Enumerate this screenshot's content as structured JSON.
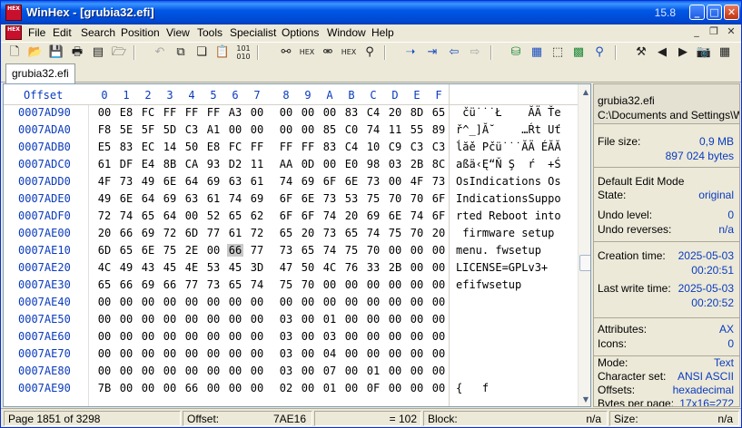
{
  "window": {
    "title": "WinHex - [grubia32.efi]",
    "version": "15.8",
    "logo_text": "HEX"
  },
  "menu": {
    "items": [
      "File",
      "Edit",
      "Search",
      "Position",
      "View",
      "Tools",
      "Specialist",
      "Options",
      "Window",
      "Help"
    ]
  },
  "toolbar": {
    "icons": [
      "new-file-icon",
      "open-folder-icon",
      "save-icon",
      "print-icon",
      "properties-icon",
      "open-folder-alt-icon",
      "undo-icon",
      "copy-block-icon",
      "copy-icon",
      "paste-icon",
      "write-clipboard-icon",
      "hex-convert-icon",
      "find-text-icon",
      "find-hex-icon",
      "replace-text-icon",
      "replace-hex-icon",
      "find-again-icon",
      "goto-offset-icon",
      "goto-sector-icon",
      "back-icon",
      "forward-icon",
      "disk-editor-icon",
      "open-ram-icon",
      "floppy-icon",
      "calculator-icon",
      "search-icon",
      "clean-icon",
      "prev-icon",
      "next-icon",
      "camera-icon",
      "grid-icon"
    ]
  },
  "tabs": {
    "active": "grubia32.efi"
  },
  "editor": {
    "offset_label": "Offset",
    "columns": [
      "0",
      "1",
      "2",
      "3",
      "4",
      "5",
      "6",
      "7",
      "8",
      "9",
      "A",
      "B",
      "C",
      "D",
      "E",
      "F"
    ],
    "selected": {
      "row": 8,
      "col": 6
    },
    "rows": [
      {
        "offset": "0007AD90",
        "bytes": [
          "00",
          "E8",
          "FC",
          "FF",
          "FF",
          "FF",
          "A3",
          "00",
          "00",
          "00",
          "00",
          "83",
          "C4",
          "20",
          "8D",
          "65"
        ],
        "text": " čü˙˙˙Ł    ĂÄ Ťe"
      },
      {
        "offset": "0007ADA0",
        "bytes": [
          "F8",
          "5E",
          "5F",
          "5D",
          "C3",
          "A1",
          "00",
          "00",
          "00",
          "00",
          "85",
          "C0",
          "74",
          "11",
          "55",
          "89"
        ],
        "text": "ř^_]Ă˘    …Ŕt Uť"
      },
      {
        "offset": "0007ADB0",
        "bytes": [
          "E5",
          "83",
          "EC",
          "14",
          "50",
          "E8",
          "FC",
          "FF",
          "FF",
          "FF",
          "83",
          "C4",
          "10",
          "C9",
          "C3",
          "C3"
        ],
        "text": "ĺăě Pčü˙˙˙ĂÄ ÉĂĂ"
      },
      {
        "offset": "0007ADC0",
        "bytes": [
          "61",
          "DF",
          "E4",
          "8B",
          "CA",
          "93",
          "D2",
          "11",
          "AA",
          "0D",
          "00",
          "E0",
          "98",
          "03",
          "2B",
          "8C"
        ],
        "text": "aßä‹Ę“Ň Ş  ŕ  +Ś"
      },
      {
        "offset": "0007ADD0",
        "bytes": [
          "4F",
          "73",
          "49",
          "6E",
          "64",
          "69",
          "63",
          "61",
          "74",
          "69",
          "6F",
          "6E",
          "73",
          "00",
          "4F",
          "73"
        ],
        "text": "OsIndications Os"
      },
      {
        "offset": "0007ADE0",
        "bytes": [
          "49",
          "6E",
          "64",
          "69",
          "63",
          "61",
          "74",
          "69",
          "6F",
          "6E",
          "73",
          "53",
          "75",
          "70",
          "70",
          "6F"
        ],
        "text": "IndicationsSuppo"
      },
      {
        "offset": "0007ADF0",
        "bytes": [
          "72",
          "74",
          "65",
          "64",
          "00",
          "52",
          "65",
          "62",
          "6F",
          "6F",
          "74",
          "20",
          "69",
          "6E",
          "74",
          "6F"
        ],
        "text": "rted Reboot into"
      },
      {
        "offset": "0007AE00",
        "bytes": [
          "20",
          "66",
          "69",
          "72",
          "6D",
          "77",
          "61",
          "72",
          "65",
          "20",
          "73",
          "65",
          "74",
          "75",
          "70",
          "20"
        ],
        "text": " firmware setup "
      },
      {
        "offset": "0007AE10",
        "bytes": [
          "6D",
          "65",
          "6E",
          "75",
          "2E",
          "00",
          "66",
          "77",
          "73",
          "65",
          "74",
          "75",
          "70",
          "00",
          "00",
          "00"
        ],
        "text": "menu. fwsetup   "
      },
      {
        "offset": "0007AE20",
        "bytes": [
          "4C",
          "49",
          "43",
          "45",
          "4E",
          "53",
          "45",
          "3D",
          "47",
          "50",
          "4C",
          "76",
          "33",
          "2B",
          "00",
          "00"
        ],
        "text": "LICENSE=GPLv3+  "
      },
      {
        "offset": "0007AE30",
        "bytes": [
          "65",
          "66",
          "69",
          "66",
          "77",
          "73",
          "65",
          "74",
          "75",
          "70",
          "00",
          "00",
          "00",
          "00",
          "00",
          "00"
        ],
        "text": "efifwsetup      "
      },
      {
        "offset": "0007AE40",
        "bytes": [
          "00",
          "00",
          "00",
          "00",
          "00",
          "00",
          "00",
          "00",
          "00",
          "00",
          "00",
          "00",
          "00",
          "00",
          "00",
          "00"
        ],
        "text": ""
      },
      {
        "offset": "0007AE50",
        "bytes": [
          "00",
          "00",
          "00",
          "00",
          "00",
          "00",
          "00",
          "00",
          "03",
          "00",
          "01",
          "00",
          "00",
          "00",
          "00",
          "00"
        ],
        "text": ""
      },
      {
        "offset": "0007AE60",
        "bytes": [
          "00",
          "00",
          "00",
          "00",
          "00",
          "00",
          "00",
          "00",
          "03",
          "00",
          "03",
          "00",
          "00",
          "00",
          "00",
          "00"
        ],
        "text": ""
      },
      {
        "offset": "0007AE70",
        "bytes": [
          "00",
          "00",
          "00",
          "00",
          "00",
          "00",
          "00",
          "00",
          "03",
          "00",
          "04",
          "00",
          "00",
          "00",
          "00",
          "00"
        ],
        "text": ""
      },
      {
        "offset": "0007AE80",
        "bytes": [
          "00",
          "00",
          "00",
          "00",
          "00",
          "00",
          "00",
          "00",
          "03",
          "00",
          "07",
          "00",
          "01",
          "00",
          "00",
          "00"
        ],
        "text": ""
      },
      {
        "offset": "0007AE90",
        "bytes": [
          "7B",
          "00",
          "00",
          "00",
          "66",
          "00",
          "00",
          "00",
          "02",
          "00",
          "01",
          "00",
          "0F",
          "00",
          "00",
          "00"
        ],
        "text": "{   f"
      }
    ]
  },
  "info": {
    "filename": "grubia32.efi",
    "path": "C:\\Documents and Settings\\Wi",
    "file_size_label": "File size:",
    "file_size_mb": "0,9 MB",
    "file_size_bytes": "897 024 bytes",
    "edit_mode": "Default Edit Mode",
    "state_label": "State:",
    "state_value": "original",
    "undo_level_label": "Undo level:",
    "undo_level_value": "0",
    "undo_reverses_label": "Undo reverses:",
    "undo_reverses_value": "n/a",
    "creation_label": "Creation time:",
    "creation_date": "2025-05-03",
    "creation_time": "00:20:51",
    "write_label": "Last write time:",
    "write_date": "2025-05-03",
    "write_time": "00:20:52",
    "attributes_label": "Attributes:",
    "attributes_value": "AX",
    "icons_label": "Icons:",
    "icons_value": "0",
    "mode_label": "Mode:",
    "mode_value": "Text",
    "charset_label": "Character set:",
    "charset_value": "ANSI ASCII",
    "offsets_label": "Offsets:",
    "offsets_value": "hexadecimal",
    "bpp_label": "Bytes per page:",
    "bpp_value": "17x16=272"
  },
  "status": {
    "page": "Page 1851 of 3298",
    "offset_label": "Offset:",
    "offset_value": "7AE16",
    "equals": "= 102",
    "block_label": "Block:",
    "block_value": "n/a",
    "size_label": "Size:",
    "size_value": "n/a"
  }
}
